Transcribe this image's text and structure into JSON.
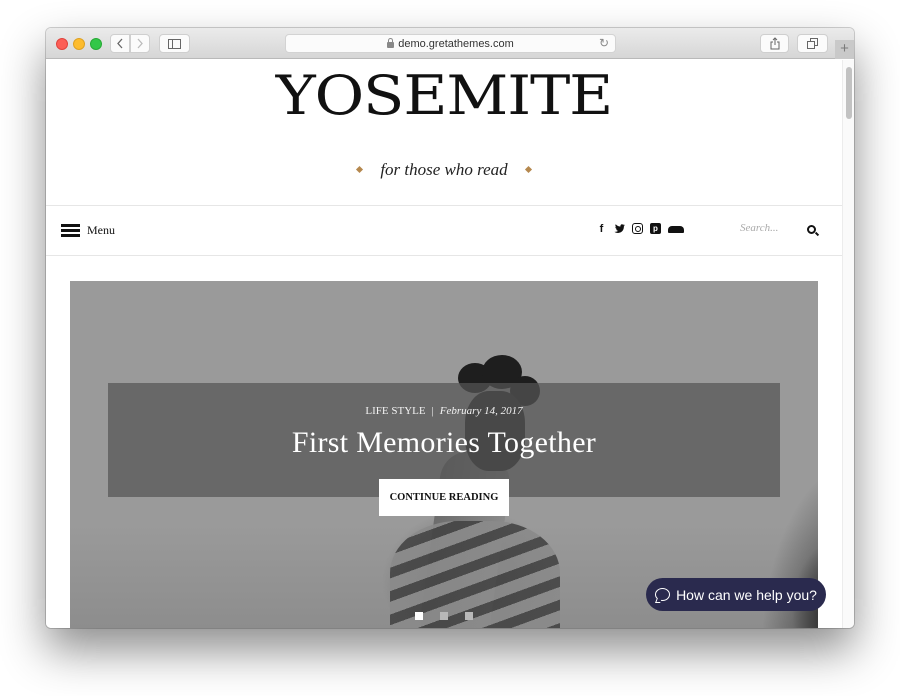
{
  "browser": {
    "address": "demo.gretathemes.com",
    "new_tab_label": "+"
  },
  "site": {
    "title": "YOSEMITE",
    "tagline": "for those who read",
    "accent_color": "#b5884e"
  },
  "navbar": {
    "menu_label": "Menu",
    "social": [
      "facebook",
      "twitter",
      "instagram",
      "pinterest",
      "soundcloud"
    ],
    "search_placeholder": "Search..."
  },
  "hero": {
    "category": "LIFE STYLE",
    "separator": "|",
    "date": "February 14, 2017",
    "title": "First Memories Together",
    "button_label": "CONTINUE READING",
    "slides": 3,
    "active_slide": 1
  },
  "chat": {
    "label": "How can we help you?",
    "color": "#2a2a4e"
  }
}
